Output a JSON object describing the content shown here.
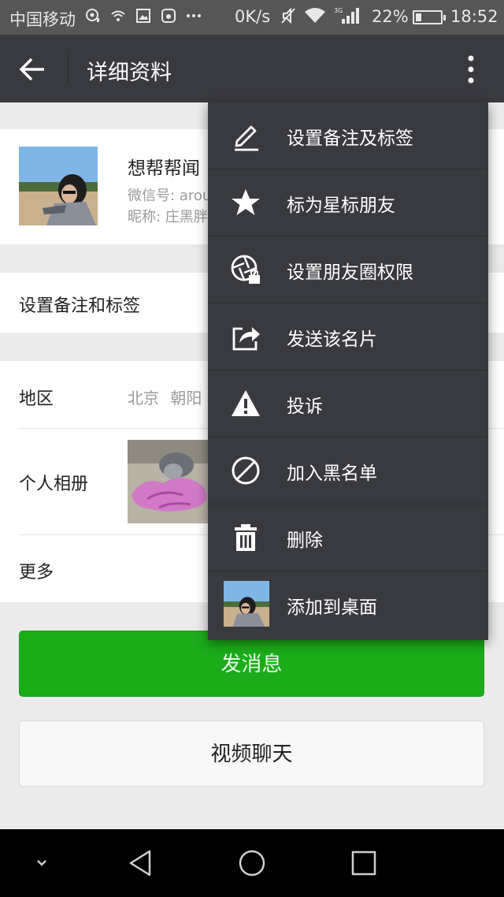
{
  "status_bar": {
    "carrier": "中国移动",
    "network_speed": "0K/s",
    "network_type": "3G",
    "battery_percent": "22%",
    "battery_level": 0.22,
    "time": "18:52",
    "icons": [
      "msg-notify-icon",
      "wifi-notify-icon",
      "image-notify-icon",
      "app-notify-icon",
      "more-notify-icon",
      "mute-icon",
      "wifi-icon",
      "signal-icon",
      "battery-icon"
    ]
  },
  "header": {
    "title": "详细资料",
    "icons": [
      "back-arrow-icon",
      "overflow-menu-icon"
    ]
  },
  "profile": {
    "display_name": "想帮帮闻",
    "wechat_id_label": "微信号: arou",
    "nickname_label": "昵称: 庄黑胖"
  },
  "rows": {
    "remark": "设置备注和标签",
    "region_label": "地区",
    "region_value": "北京 朝阳",
    "album_label": "个人相册",
    "more_label": "更多"
  },
  "actions": {
    "send_message": "发消息",
    "video_chat": "视频聊天"
  },
  "menu": {
    "items": [
      {
        "label": "设置备注及标签",
        "icon": "pencil-icon"
      },
      {
        "label": "标为星标朋友",
        "icon": "star-icon"
      },
      {
        "label": "设置朋友圈权限",
        "icon": "moments-lock-icon"
      },
      {
        "label": "发送该名片",
        "icon": "share-icon"
      },
      {
        "label": "投诉",
        "icon": "warning-icon"
      },
      {
        "label": "加入黑名单",
        "icon": "block-icon"
      },
      {
        "label": "删除",
        "icon": "trash-icon"
      },
      {
        "label": "添加到桌面",
        "icon": "avatar-thumbnail"
      }
    ]
  },
  "nav_bar": {
    "icons": [
      "hide-keyboard-icon",
      "back-triangle-icon",
      "home-circle-icon",
      "recents-square-icon"
    ]
  },
  "colors": {
    "title_bar": "#393a3f",
    "menu_bg": "#393a3f",
    "accent_green": "#1aad19",
    "page_bg": "#ebebeb"
  }
}
